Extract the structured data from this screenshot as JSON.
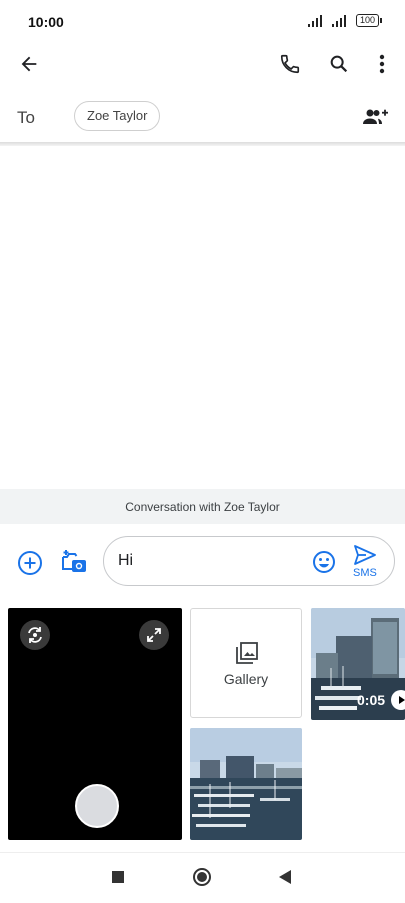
{
  "status_bar": {
    "time": "10:00",
    "battery": "100"
  },
  "app_bar": {
    "back_icon": "arrow-back-icon",
    "call_icon": "phone-icon",
    "search_icon": "search-icon",
    "menu_icon": "more-vert-icon"
  },
  "recipients": {
    "to_label": "To",
    "chips": [
      "Zoe Taylor"
    ],
    "add_icon": "group-add-icon"
  },
  "conversation": {
    "label": "Conversation with Zoe Taylor"
  },
  "compose": {
    "text": "Hi",
    "send_label": "SMS",
    "emoji_icon": "emoji-icon",
    "add_icon": "add-circle-icon",
    "camera_icon": "add-photo-icon"
  },
  "media_picker": {
    "gallery_label": "Gallery",
    "video_duration": "0:05"
  },
  "colors": {
    "accent": "#1a73e8"
  },
  "nav_bar": {
    "icons": [
      "recents-square-icon",
      "home-circle-icon",
      "back-triangle-icon"
    ]
  }
}
